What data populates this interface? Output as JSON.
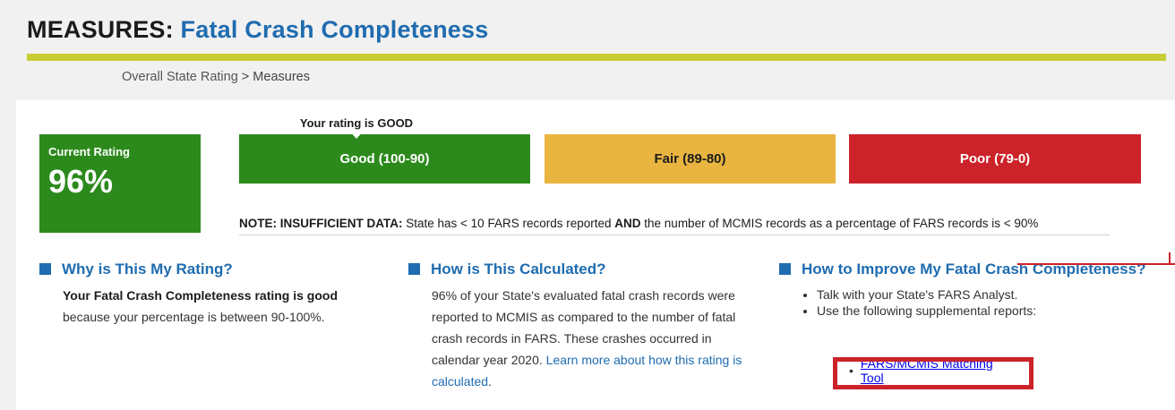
{
  "title": {
    "prefix": "MEASURES:",
    "name": "Fatal Crash Completeness"
  },
  "breadcrumb": {
    "parent": "Overall State Rating",
    "separator": " > ",
    "current": "Measures"
  },
  "current_rating": {
    "label": "Current Rating",
    "value": "96%"
  },
  "rating_caption": "Your rating is GOOD",
  "bands": {
    "good": "Good (100-90)",
    "fair": "Fair (89-80)",
    "poor": "Poor (79-0)"
  },
  "note": {
    "lead": "NOTE: INSUFFICIENT DATA:",
    "part1": "State has < 10 FARS records reported",
    "and": "AND",
    "part2": "the number of MCMIS records as a percentage of FARS records is < 90%"
  },
  "why": {
    "heading": "Why is This My Rating?",
    "bold": "Your Fatal Crash Completeness rating is good",
    "text": "because your percentage is between 90-100%."
  },
  "how": {
    "heading": "How is This Calculated?",
    "text": "96% of your State's evaluated fatal crash records were reported to MCMIS as compared to the number of fatal crash records in FARS. These crashes occurred in calendar year 2020.",
    "link": "Learn more about how this rating is calculated",
    "after": "."
  },
  "improve": {
    "heading": "How to Improve My Fatal Crash Completeness?",
    "items": [
      "Talk with your State's FARS Analyst.",
      "Use the following supplemental reports:"
    ],
    "tool_link": "FARS/MCMIS Matching Tool"
  },
  "colors": {
    "good": "#2c8a1c",
    "fair": "#e9b540",
    "poor": "#cc2229",
    "accent": "#1f6cb0",
    "rule": "#c8cc35"
  }
}
